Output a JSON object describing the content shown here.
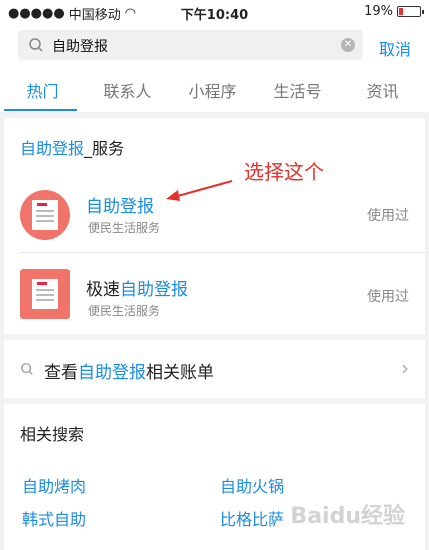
{
  "status": {
    "carrier": "中国移动",
    "time": "下午10:40",
    "battery": "19%",
    "battery_level": 0.19,
    "battery_color": "#e33333"
  },
  "search": {
    "query": "自助登报",
    "cancel": "取消"
  },
  "tabs": [
    "热门",
    "联系人",
    "小程序",
    "生活号",
    "资讯"
  ],
  "section": {
    "highlight": "自助登报",
    "suffix": "_服务"
  },
  "items": [
    {
      "title_prefix": "",
      "title_highlight": "自助登报",
      "sub": "便民生活服务",
      "used": "使用过"
    },
    {
      "title_prefix": "极速",
      "title_highlight": "自助登报",
      "sub": "便民生活服务",
      "used": "使用过"
    }
  ],
  "annotation": "选择这个",
  "bill": {
    "prefix": "查看",
    "highlight": "自助登报",
    "suffix": "相关账单"
  },
  "related": {
    "title": "相关搜索",
    "items": [
      "自助烤肉",
      "自助火锅",
      "韩式自助",
      "比格比萨"
    ]
  },
  "watermark": "Baidu经验",
  "accent": "#1a8ce6"
}
